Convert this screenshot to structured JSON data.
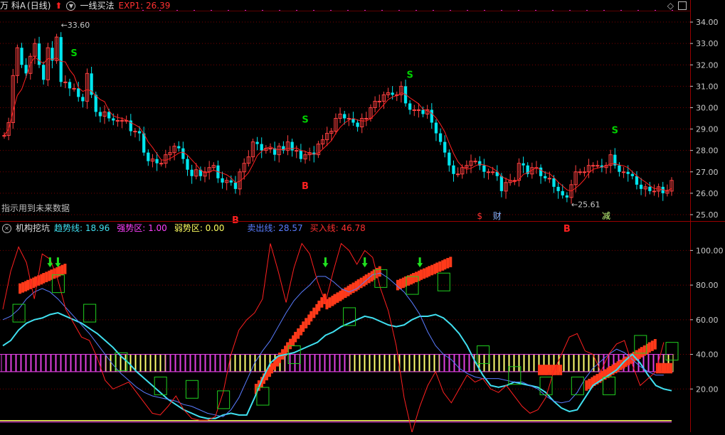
{
  "top_header": {
    "stock_name": "万 科A",
    "period": "(日线)",
    "indicator_name": "一线买法",
    "exp_label": "EXP1: 26.39",
    "right_icons": [
      "diamond-icon",
      "restore-icon"
    ]
  },
  "top_note": "指示用到未来数据",
  "bottom_header": {
    "indicator_name": "机构挖坑",
    "items": [
      {
        "label": "趋势线:",
        "value": "18.96",
        "color": "#40e0f0"
      },
      {
        "label": "强势区:",
        "value": "1.00",
        "color": "#ff40ff"
      },
      {
        "label": "弱势区:",
        "value": "0.00",
        "color": "#ffff60"
      },
      {
        "label": "卖出线:",
        "value": "28.57",
        "color": "#5a7cff"
      },
      {
        "label": "买入线:",
        "value": "46.78",
        "color": "#ff3030"
      }
    ]
  },
  "colors": {
    "up": "#ff4040",
    "down": "#00e5ee",
    "ma": "#ff2020",
    "grid": "#7a0000",
    "axis_text": "#c8c8c8",
    "buy": "#ff2020",
    "sell": "#00d000"
  },
  "chart_data": [
    {
      "type": "candlestick",
      "ylim": [
        24.7,
        34.5
      ],
      "yticks": [
        25.0,
        26.0,
        27.0,
        28.0,
        29.0,
        30.0,
        31.0,
        32.0,
        33.0,
        34.0
      ],
      "close": [
        28.7,
        29.3,
        31.5,
        32.8,
        32.0,
        31.6,
        32.4,
        33.0,
        32.0,
        31.3,
        32.8,
        32.2,
        33.3,
        31.2,
        31.2,
        30.9,
        30.9,
        30.5,
        30.3,
        31.6,
        30.6,
        29.8,
        29.6,
        29.8,
        29.5,
        29.4,
        29.4,
        29.4,
        29.4,
        28.9,
        28.9,
        28.8,
        27.9,
        27.5,
        27.6,
        27.4,
        27.4,
        27.8,
        27.9,
        28.2,
        28.1,
        27.6,
        27.1,
        26.8,
        27.1,
        26.8,
        27.0,
        27.2,
        27.3,
        26.7,
        26.5,
        26.6,
        26.5,
        26.2,
        27.0,
        27.4,
        27.7,
        28.4,
        28.3,
        28.0,
        28.1,
        28.1,
        27.8,
        28.2,
        28.0,
        28.4,
        28.0,
        28.0,
        27.6,
        27.8,
        27.9,
        27.8,
        28.3,
        28.5,
        28.8,
        28.9,
        29.5,
        29.7,
        29.5,
        29.5,
        29.3,
        29.1,
        29.5,
        29.5,
        30.0,
        30.3,
        30.3,
        30.6,
        30.7,
        30.6,
        30.6,
        31.0,
        30.2,
        29.9,
        29.9,
        29.9,
        29.7,
        29.9,
        29.3,
        28.8,
        28.4,
        27.9,
        27.3,
        26.9,
        26.9,
        27.2,
        27.3,
        27.5,
        27.5,
        27.3,
        27.0,
        27.0,
        27.0,
        26.8,
        26.1,
        26.5,
        26.6,
        26.6,
        27.4,
        27.3,
        26.9,
        27.2,
        27.2,
        26.8,
        26.7,
        26.7,
        26.3,
        26.1,
        25.9,
        25.8,
        26.4,
        27.0,
        27.0,
        27.0,
        27.3,
        27.3,
        27.3,
        27.2,
        27.3,
        27.8,
        27.3,
        27.0,
        27.0,
        26.9,
        26.8,
        26.4,
        26.2,
        26.3,
        26.1,
        26.1,
        26.3,
        26.0,
        26.1,
        26.6
      ],
      "open": [
        28.7,
        28.7,
        29.3,
        31.5,
        32.8,
        32.0,
        31.6,
        32.4,
        33.0,
        32.0,
        31.3,
        32.8,
        32.2,
        33.3,
        31.2,
        31.2,
        30.9,
        30.9,
        30.5,
        30.3,
        31.6,
        30.6,
        29.8,
        29.6,
        29.8,
        29.5,
        29.4,
        29.4,
        29.4,
        29.4,
        28.9,
        28.9,
        28.8,
        27.9,
        27.5,
        27.6,
        27.4,
        27.4,
        27.8,
        27.9,
        28.2,
        28.1,
        27.6,
        27.1,
        26.8,
        27.1,
        26.8,
        27.0,
        27.2,
        27.3,
        26.7,
        26.5,
        26.6,
        26.5,
        26.2,
        27.0,
        27.4,
        27.7,
        28.4,
        28.3,
        28.0,
        28.1,
        28.1,
        27.8,
        28.2,
        28.0,
        28.4,
        28.0,
        28.0,
        27.6,
        27.8,
        27.9,
        27.8,
        28.3,
        28.5,
        28.8,
        28.9,
        29.5,
        29.7,
        29.5,
        29.5,
        29.3,
        29.1,
        29.5,
        29.5,
        30.0,
        30.3,
        30.3,
        30.6,
        30.7,
        30.6,
        30.6,
        31.0,
        30.2,
        29.9,
        29.9,
        29.9,
        29.7,
        29.9,
        29.3,
        28.8,
        28.4,
        27.9,
        27.3,
        26.9,
        26.9,
        27.2,
        27.3,
        27.5,
        27.5,
        27.3,
        27.0,
        27.0,
        27.0,
        26.8,
        26.1,
        26.5,
        26.6,
        26.6,
        27.4,
        27.3,
        26.9,
        27.2,
        27.2,
        26.8,
        26.7,
        26.7,
        26.3,
        26.1,
        25.9,
        25.8,
        26.4,
        27.0,
        27.0,
        27.0,
        27.3,
        27.3,
        27.3,
        27.2,
        27.3,
        27.8,
        27.3,
        27.0,
        27.0,
        26.9,
        26.8,
        26.4,
        26.2,
        26.3,
        26.1,
        26.1,
        26.3,
        26.0,
        26.1
      ],
      "price_labels": [
        {
          "text": "33.60",
          "value": 33.6
        },
        {
          "text": "25.61",
          "value": 25.61
        }
      ],
      "signals": [
        {
          "text": "S",
          "type": "sell",
          "index": 16
        },
        {
          "text": "B",
          "type": "buy",
          "index": 53
        },
        {
          "text": "S",
          "type": "sell",
          "index": 69
        },
        {
          "text": "B",
          "type": "buy",
          "index": 69
        },
        {
          "text": "S",
          "type": "sell",
          "index": 93
        },
        {
          "text": "B",
          "type": "buy",
          "index": 129
        },
        {
          "text": "S",
          "type": "sell",
          "index": 140
        }
      ],
      "bottom_markers": [
        {
          "text": "$",
          "color": "#ff3030",
          "index": 109
        },
        {
          "text": "财",
          "color": "#8ab4ff",
          "index": 113
        },
        {
          "text": "减",
          "color": "#c8ff80",
          "index": 138
        }
      ]
    },
    {
      "type": "line",
      "ylim": [
        0,
        110
      ],
      "yticks": [
        20.0,
        40.0,
        60.0,
        80.0,
        100.0
      ],
      "series": [
        {
          "name": "趋势线",
          "color": "#40e0f0",
          "values": [
            45,
            48,
            54,
            58,
            60,
            61,
            63,
            64,
            62,
            60,
            58,
            55,
            52,
            48,
            44,
            39,
            35,
            30,
            26,
            22,
            18,
            14,
            11,
            8,
            6,
            4,
            3,
            3,
            5,
            6,
            5,
            5,
            15,
            26,
            35,
            39,
            40,
            41,
            43,
            45,
            47,
            51,
            53,
            56,
            58,
            60,
            62,
            61,
            59,
            57,
            56,
            57,
            60,
            62,
            62,
            63,
            61,
            57,
            52,
            45,
            36,
            28,
            22,
            21,
            22,
            24,
            23,
            22,
            21,
            18,
            13,
            9,
            7,
            8,
            15,
            22,
            25,
            28,
            31,
            36,
            40,
            35,
            28,
            22,
            20,
            19
          ]
        },
        {
          "name": "卖出线",
          "color": "#5a7cff",
          "values": [
            60,
            62,
            66,
            72,
            76,
            78,
            76,
            72,
            67,
            62,
            57,
            52,
            46,
            40,
            34,
            29,
            25,
            21,
            18,
            16,
            15,
            14,
            13,
            11,
            10,
            8,
            6,
            5,
            4,
            8,
            15,
            25,
            35,
            42,
            48,
            56,
            64,
            71,
            76,
            80,
            85,
            85,
            82,
            78,
            76,
            78,
            82,
            86,
            87,
            84,
            80,
            76,
            70,
            63,
            53,
            45,
            40,
            37,
            32,
            29,
            27,
            26,
            26,
            26,
            25,
            24,
            24,
            22,
            20,
            16,
            13,
            12,
            13,
            18,
            26,
            32,
            36,
            40,
            43,
            41,
            37,
            33,
            30,
            28,
            28
          ]
        },
        {
          "name": "买入线",
          "color": "#ff2020",
          "values": [
            66,
            88,
            102,
            93,
            72,
            98,
            95,
            83,
            66,
            58,
            50,
            48,
            38,
            25,
            20,
            22,
            24,
            18,
            12,
            6,
            5,
            10,
            16,
            8,
            3,
            2,
            2,
            4,
            18,
            40,
            54,
            60,
            64,
            72,
            104,
            88,
            70,
            90,
            104,
            98,
            82,
            70,
            88,
            104,
            100,
            92,
            100,
            96,
            78,
            65,
            45,
            15,
            -10,
            10,
            22,
            30,
            18,
            12,
            20,
            28,
            24,
            26,
            20,
            18,
            22,
            16,
            10,
            6,
            8,
            15,
            30,
            40,
            50,
            52,
            42,
            40,
            30,
            40,
            46,
            48,
            34,
            22,
            26,
            30,
            47
          ]
        },
        {
          "name": "强势区",
          "color": "#ff40ff",
          "values": [
            1,
            1,
            1,
            1,
            1,
            1,
            1,
            1,
            1,
            1
          ]
        },
        {
          "name": "弱势区",
          "color": "#ffff60",
          "values": [
            0,
            0,
            0,
            0,
            0,
            0,
            0,
            0,
            0,
            0
          ]
        }
      ],
      "zone_low": 30,
      "zone_high": 40,
      "zone_yellow_ranges": [
        [
          13,
          20
        ],
        [
          29,
          35
        ],
        [
          44,
          55
        ],
        [
          60,
          75
        ],
        [
          84,
          87
        ]
      ],
      "red_step_ranges": [
        {
          "start": 2,
          "end": 7,
          "from": 78,
          "to": 88
        },
        {
          "start": 32,
          "end": 40,
          "from": 20,
          "to": 68
        },
        {
          "start": 41,
          "end": 47,
          "from": 69,
          "to": 86
        },
        {
          "start": 50,
          "end": 56,
          "from": 80,
          "to": 92
        },
        {
          "start": 68,
          "end": 70,
          "from": 31,
          "to": 31
        },
        {
          "start": 74,
          "end": 82,
          "from": 22,
          "to": 44
        },
        {
          "start": 83,
          "end": 84,
          "from": 32,
          "to": 32
        }
      ],
      "green_boxes": [
        {
          "index": 2,
          "value": 64
        },
        {
          "index": 7,
          "value": 81
        },
        {
          "index": 11,
          "value": 64
        },
        {
          "index": 15,
          "value": 36
        },
        {
          "index": 20,
          "value": 22
        },
        {
          "index": 24,
          "value": 20
        },
        {
          "index": 28,
          "value": 14
        },
        {
          "index": 33,
          "value": 16
        },
        {
          "index": 37,
          "value": 40
        },
        {
          "index": 44,
          "value": 62
        },
        {
          "index": 48,
          "value": 84
        },
        {
          "index": 52,
          "value": 80
        },
        {
          "index": 56,
          "value": 82
        },
        {
          "index": 61,
          "value": 40
        },
        {
          "index": 65,
          "value": 28
        },
        {
          "index": 69,
          "value": 22
        },
        {
          "index": 73,
          "value": 22
        },
        {
          "index": 77,
          "value": 22
        },
        {
          "index": 81,
          "value": 46
        },
        {
          "index": 85,
          "value": 42
        }
      ],
      "down_arrows": [
        {
          "index": 6,
          "value": 96
        },
        {
          "index": 7,
          "value": 96
        },
        {
          "index": 41,
          "value": 96
        },
        {
          "index": 46,
          "value": 96
        },
        {
          "index": 53,
          "value": 96
        }
      ]
    }
  ]
}
